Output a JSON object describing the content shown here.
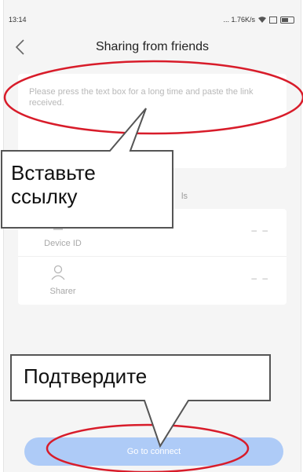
{
  "status_bar": {
    "time": "13:14",
    "speed": "... 1.76K/s"
  },
  "header": {
    "title": "Sharing from friends"
  },
  "text_box": {
    "placeholder": "Please press the text box for a long time and paste the link received."
  },
  "info_section": {
    "label_tail": "ls",
    "rows": [
      {
        "icon": "device-icon",
        "label": "Device ID",
        "value": "– –"
      },
      {
        "icon": "user-icon",
        "label": "Sharer",
        "value": "– –"
      }
    ]
  },
  "connect_button": {
    "label": "Go to connect"
  },
  "callouts": {
    "paste": {
      "line1": "Вставьте",
      "line2": "ссылку"
    },
    "confirm": {
      "text": "Подтвердите"
    }
  },
  "colors": {
    "accent_button": "#aecbf7",
    "annotation_ellipse": "#d81c2a",
    "background": "#f5f5f5"
  }
}
